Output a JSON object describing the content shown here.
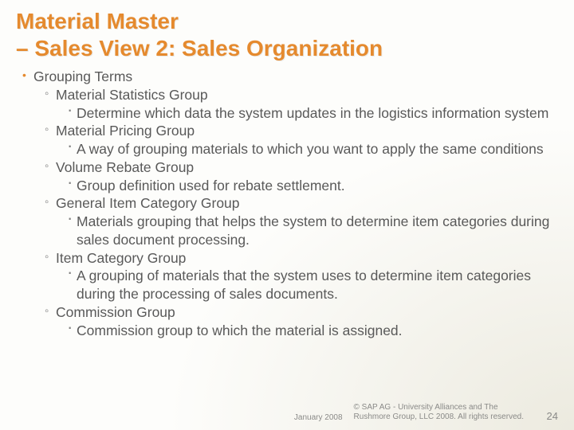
{
  "title_line1": "Material Master",
  "title_line2": "– Sales View 2: Sales Organization",
  "top": "Grouping Terms",
  "groups": [
    {
      "name": "Material Statistics Group",
      "desc": "Determine which data the system updates in the logistics information system"
    },
    {
      "name": "Material Pricing Group",
      "desc": "A way of grouping materials to which you want to apply the same conditions"
    },
    {
      "name": "Volume Rebate Group",
      "desc": "Group definition used for rebate settlement."
    },
    {
      "name": "General Item Category Group",
      "desc": "Materials grouping that helps the system to determine item categories during sales document processing."
    },
    {
      "name": "Item Category Group",
      "desc": "A grouping of materials that the system uses to determine item categories during the processing of sales documents."
    },
    {
      "name": "Commission Group",
      "desc": "Commission group to which the material is assigned."
    }
  ],
  "footer": {
    "date": "January 2008",
    "copyright": "© SAP AG - University Alliances and The Rushmore Group, LLC 2008. All rights reserved.",
    "page": "24"
  }
}
